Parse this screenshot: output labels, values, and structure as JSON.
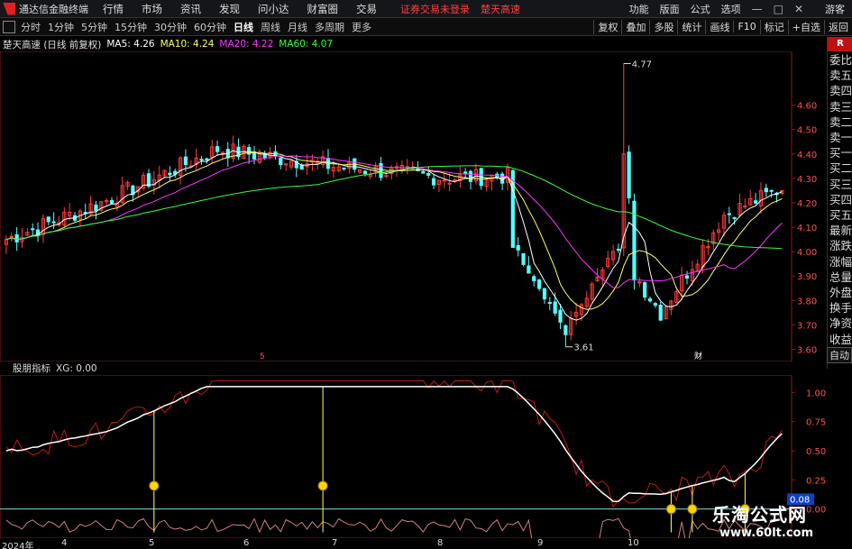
{
  "menubar": {
    "app_name": "通达信金融终端",
    "menus": [
      "行情",
      "市场",
      "资讯",
      "发现",
      "问小达",
      "财富圈",
      "交易"
    ],
    "status": "证券交易未登录",
    "stock": "楚天高速",
    "right_menus": [
      "功能",
      "版面",
      "公式",
      "选项"
    ],
    "guest": "游客"
  },
  "toolbar": {
    "periods": [
      "分时",
      "1分钟",
      "5分钟",
      "15分钟",
      "30分钟",
      "60分钟",
      "日线",
      "周线",
      "月线",
      "多周期",
      "更多"
    ],
    "active": "日线",
    "tools": [
      "复权",
      "叠加",
      "多股",
      "统计",
      "画线",
      "F10",
      "标记",
      "+自选",
      "返回"
    ]
  },
  "info": {
    "name": "楚天高速 (日线 前复权)",
    "ma5": "MA5: 4.26",
    "ma10": "MA10: 4.24",
    "ma20": "MA20: 4.22",
    "ma60": "MA60: 4.07"
  },
  "colors": {
    "up": "#ff3b3b",
    "down": "#54ffff",
    "ma5": "#ffffff",
    "ma10": "#ffff66",
    "ma20": "#ff33ff",
    "ma60": "#33ff33"
  },
  "price_axis": [
    "4.60",
    "4.50",
    "4.40",
    "4.30",
    "4.20",
    "4.10",
    "4.00",
    "3.90",
    "3.80",
    "3.70",
    "3.60"
  ],
  "annotations": {
    "high": "4.77",
    "low": "3.61",
    "marker1": "5",
    "marker2": "财"
  },
  "side_panel": {
    "r": "R",
    "items": [
      "委比",
      "卖五",
      "卖四",
      "卖三",
      "卖二",
      "卖一",
      "买一",
      "买二",
      "买三",
      "买四",
      "买五",
      "最新",
      "涨跌",
      "涨幅",
      "总量",
      "外盘",
      "换手",
      "净资",
      "收益"
    ],
    "auto": "自动"
  },
  "indicator": {
    "name": "股朋指标",
    "xg": "XG: 0.00",
    "axis": [
      "1.00",
      "0.75",
      "0.50",
      "0.25",
      "0.00"
    ],
    "current": "0.08"
  },
  "x_axis": [
    "2024年",
    "4",
    "5",
    "6",
    "7",
    "8",
    "9",
    "10"
  ],
  "watermark": {
    "title": "乐淘公式网",
    "url": "www.60lt.com"
  },
  "chart_data": {
    "type": "candlestick",
    "title": "楚天高速 (日线 前复权)",
    "ylim": [
      3.55,
      4.82
    ],
    "anchor_closes": [
      {
        "month": "2024年",
        "close": 4.05
      },
      {
        "month": "4",
        "close": 4.2
      },
      {
        "month": "5",
        "close": 4.42
      },
      {
        "month": "6",
        "close": 4.35
      },
      {
        "month": "7",
        "close": 4.3
      },
      {
        "month": "8",
        "close": 4.32
      },
      {
        "month": "9",
        "close": 3.75
      },
      {
        "month": "10",
        "close": 4.15
      },
      {
        "month": "latest",
        "close": 4.26
      }
    ],
    "extremes": {
      "high": 4.77,
      "low": 3.61
    },
    "moving_averages": {
      "MA5": 4.26,
      "MA10": 4.24,
      "MA20": 4.22,
      "MA60": 4.07
    },
    "indicator": {
      "name": "股朋指标",
      "XG": 0.0,
      "latest": 0.08,
      "ylim": [
        -0.25,
        1.15
      ]
    }
  }
}
